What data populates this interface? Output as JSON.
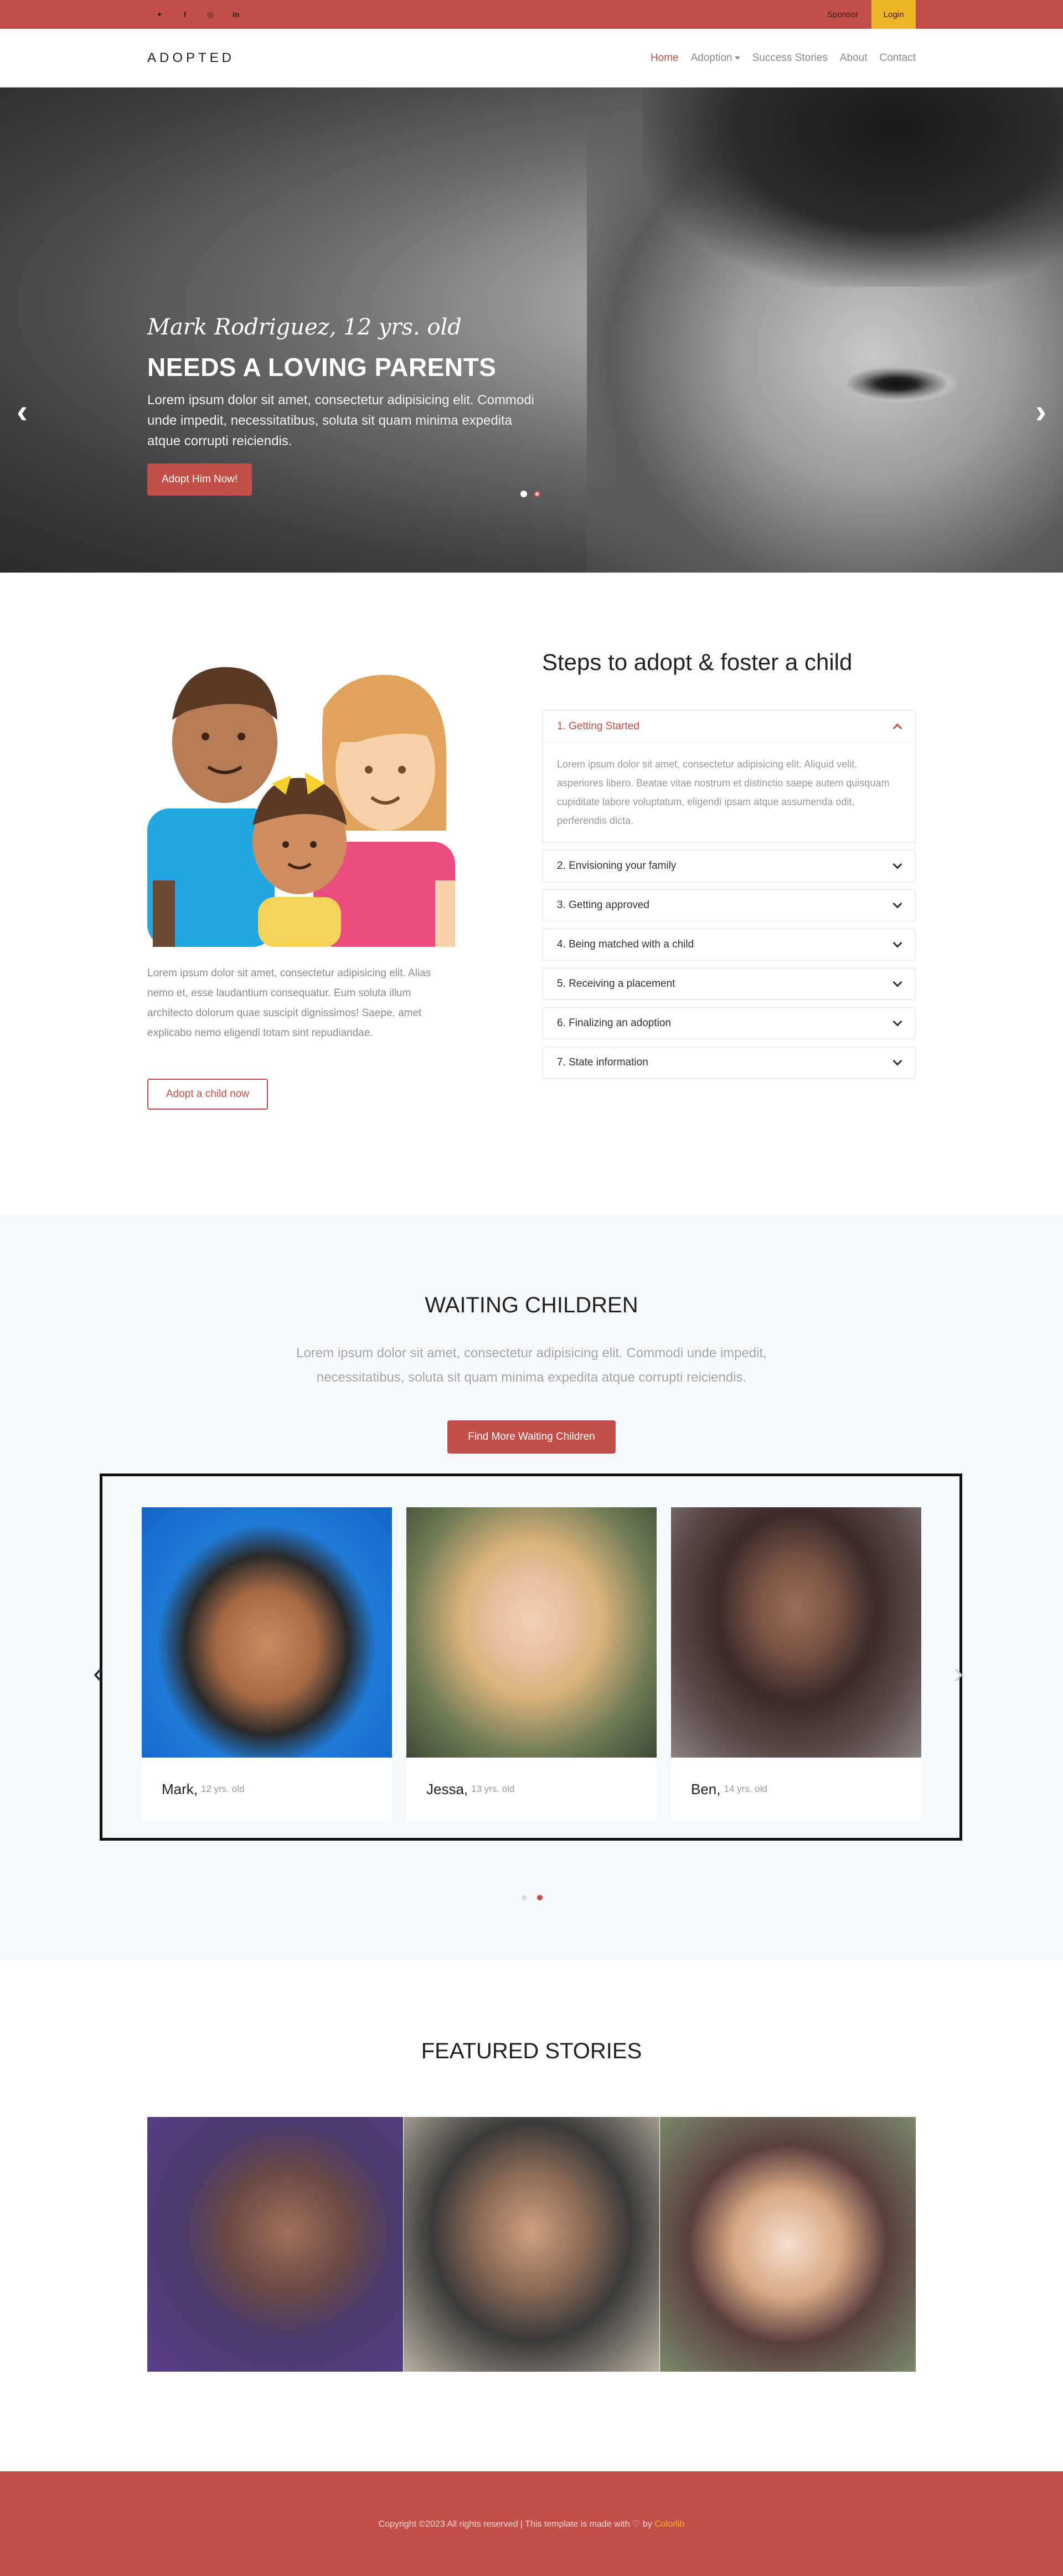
{
  "topbar": {
    "social": [
      {
        "icon": "twitter-icon",
        "glyph": "🐦"
      },
      {
        "icon": "facebook-icon",
        "glyph": "f"
      },
      {
        "icon": "instagram-icon",
        "glyph": "◎"
      },
      {
        "icon": "linkedin-icon",
        "glyph": "in"
      }
    ],
    "sponsor": "Sponsor",
    "login": "Login"
  },
  "nav": {
    "brand": "ADOPTED",
    "items": [
      "Home",
      "Adoption",
      "Success Stories",
      "About",
      "Contact"
    ]
  },
  "hero": {
    "script": "Mark Rodriguez, 12 yrs. old",
    "title": "NEEDS A LOVING PARENTS",
    "text": "Lorem ipsum dolor sit amet, consectetur adipisicing elit. Commodi unde impedit, necessitatibus, soluta sit quam minima expedita atque corrupti reiciendis.",
    "button": "Adopt Him Now!",
    "prev": "‹",
    "next": "›"
  },
  "steps": {
    "intro": "Lorem ipsum dolor sit amet, consectetur adipisicing elit. Alias nemo et, esse laudantium consequatur. Eum soluta illum architecto dolorum quae suscipit dignissimos! Saepe, amet explicabo nemo eligendi totam sint repudiandae.",
    "button": "Adopt a child now",
    "title": "Steps to adopt & foster a child",
    "items": [
      "1. Getting Started",
      "2. Envisioning your family",
      "3. Getting approved",
      "4. Being matched with a child",
      "5. Receiving a placement",
      "6. Finalizing an adoption",
      "7. State information"
    ],
    "open_body": "Lorem ipsum dolor sit amet, consectetur adipisicing elit. Aliquid velit, asperiores libero. Beatae vitae nostrum et distinctio saepe autem quisquam cupiditate labore voluptatum, eligendi ipsam atque assumenda odit, perferendis dicta."
  },
  "waiting": {
    "title": "WAITING CHILDREN",
    "text": "Lorem ipsum dolor sit amet, consectetur adipisicing elit. Commodi unde impedit, necessitatibus, soluta sit quam minima expedita atque corrupti reiciendis.",
    "button": "Find More Waiting Children",
    "children": [
      {
        "name": "Mark,",
        "age": "12 yrs. old"
      },
      {
        "name": "Jessa,",
        "age": "13 yrs. old"
      },
      {
        "name": "Ben,",
        "age": "14 yrs. old"
      }
    ],
    "prev": "‹",
    "next": "›"
  },
  "featured": {
    "title": "FEATURED STORIES"
  },
  "footer": {
    "text": "Copyright ©2023 All rights reserved | This template is made with ♡ by ",
    "brand": "Colorlib"
  }
}
